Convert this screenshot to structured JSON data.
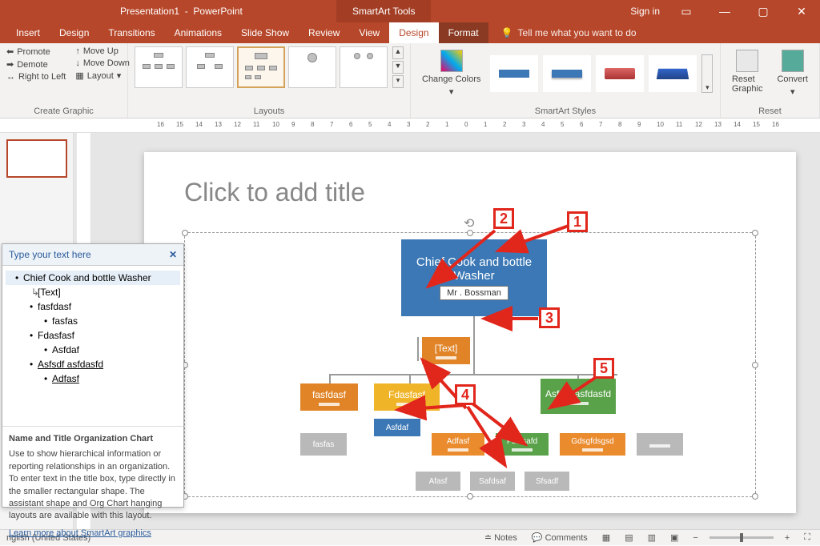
{
  "titlebar": {
    "doc": "Presentation1",
    "app": "PowerPoint",
    "tool": "SmartArt Tools",
    "signin": "Sign in"
  },
  "tabs": {
    "insert": "Insert",
    "design": "Design",
    "transitions": "Transitions",
    "animations": "Animations",
    "slideshow": "Slide Show",
    "review": "Review",
    "view": "View",
    "sa_design": "Design",
    "sa_format": "Format",
    "tell": "Tell me what you want to do"
  },
  "ribbon": {
    "create": {
      "promote": "Promote",
      "demote": "Demote",
      "rtl": "Right to Left",
      "moveup": "Move Up",
      "movedown": "Move Down",
      "layout": "Layout",
      "group": "Create Graphic"
    },
    "layouts_group": "Layouts",
    "colors": "Change Colors",
    "styles_group": "SmartArt Styles",
    "reset": {
      "reset": "Reset Graphic",
      "convert": "Convert",
      "group": "Reset"
    }
  },
  "slide": {
    "title_placeholder": "Click to add title"
  },
  "org": {
    "root": {
      "title": "Chief Cook and bottle Washer",
      "name": "Mr . Bossman"
    },
    "asst": "[Text]",
    "l2": [
      "fasfdasf",
      "Fdasfasf",
      "Asfsdf asfdasfd"
    ],
    "l3a": [
      "fasfas"
    ],
    "l3b": [
      "Asfdaf",
      "Adfasf",
      "Fsafsafd",
      "Gdsgfdsgsd",
      ""
    ],
    "l4": [
      "Afasf",
      "Safdsaf",
      "Sfsadf"
    ]
  },
  "textpane": {
    "header": "Type your text here",
    "items": [
      {
        "t": "Chief Cook and bottle Washer",
        "lvl": "root"
      },
      {
        "t": "[Text]",
        "lvl": "arrow"
      },
      {
        "t": "fasfdasf",
        "lvl": "1"
      },
      {
        "t": "fasfas",
        "lvl": "2"
      },
      {
        "t": "Fdasfasf",
        "lvl": "1"
      },
      {
        "t": "Asfdaf",
        "lvl": "2"
      },
      {
        "t": "Asfsdf asfdasfd",
        "lvl": "1",
        "u": true
      },
      {
        "t": "Adfasf",
        "lvl": "2",
        "u": true
      }
    ],
    "desc_title": "Name and Title Organization Chart",
    "desc": "Use to show hierarchical information or reporting relationships in an organization. To enter text in the title box, type directly in the smaller rectangular shape. The assistant shape and Org Chart hanging layouts are available with this layout.",
    "link": "Learn more about SmartArt graphics"
  },
  "annotations": [
    "1",
    "2",
    "3",
    "4",
    "5"
  ],
  "status": {
    "lang": "nglish (United States)",
    "notes": "Notes",
    "comments": "Comments"
  },
  "chart_data": {
    "type": "org-chart",
    "title": "Name and Title Organization Chart",
    "root": {
      "title": "Chief Cook and bottle Washer",
      "name": "Mr . Bossman",
      "assistant": "[Text]",
      "children": [
        {
          "title": "fasfdasf",
          "children": [
            {
              "title": "fasfas"
            }
          ]
        },
        {
          "title": "Fdasfasf",
          "children": [
            {
              "title": "Asfdaf"
            },
            {
              "title": "Adfasf",
              "children": [
                {
                  "title": "Afasf"
                },
                {
                  "title": "Safdsaf"
                },
                {
                  "title": "Sfsadf"
                }
              ]
            },
            {
              "title": "Fsafsafd"
            },
            {
              "title": "Gdsgfdsgsd"
            },
            {
              "title": ""
            }
          ]
        },
        {
          "title": "Asfsdf asfdasfd"
        }
      ]
    }
  }
}
